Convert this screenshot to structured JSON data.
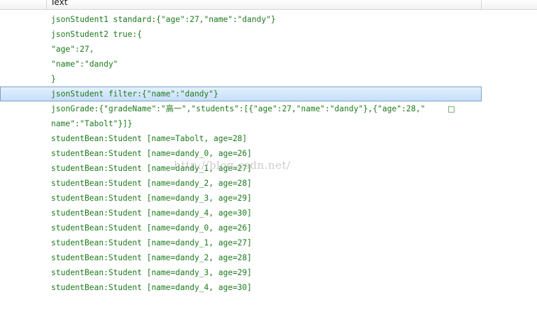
{
  "header": {
    "column_label": "Text"
  },
  "lines": [
    "jsonStudent1 standard:{\"age\":27,\"name\":\"dandy\"}",
    "jsonStudent2 true:{",
    "\"age\":27,",
    "\"name\":\"dandy\"",
    "}",
    "jsonStudent filter:{\"name\":\"dandy\"}",
    "jsonGrade:{\"gradeName\":\"高一\",\"students\":[{\"age\":27,\"name\":\"dandy\"},{\"age\":28,\"",
    "name\":\"Tabolt\"}]}",
    "studentBean:Student [name=Tabolt, age=28]",
    "studentBean:Student [name=dandy_0, age=26]",
    "studentBean:Student [name=dandy_1, age=27]",
    "studentBean:Student [name=dandy_2, age=28]",
    "studentBean:Student [name=dandy_3, age=29]",
    "studentBean:Student [name=dandy_4, age=30]",
    "studentBean:Student [name=dandy_0, age=26]",
    "studentBean:Student [name=dandy_1, age=27]",
    "studentBean:Student [name=dandy_2, age=28]",
    "studentBean:Student [name=dandy_3, age=29]",
    "studentBean:Student [name=dandy_4, age=30]"
  ],
  "overflow_glyph": "□",
  "watermark": "http://blog.csdn.net/",
  "colors": {
    "text": "#1d7a1d",
    "selection_border": "#7da2ce"
  }
}
